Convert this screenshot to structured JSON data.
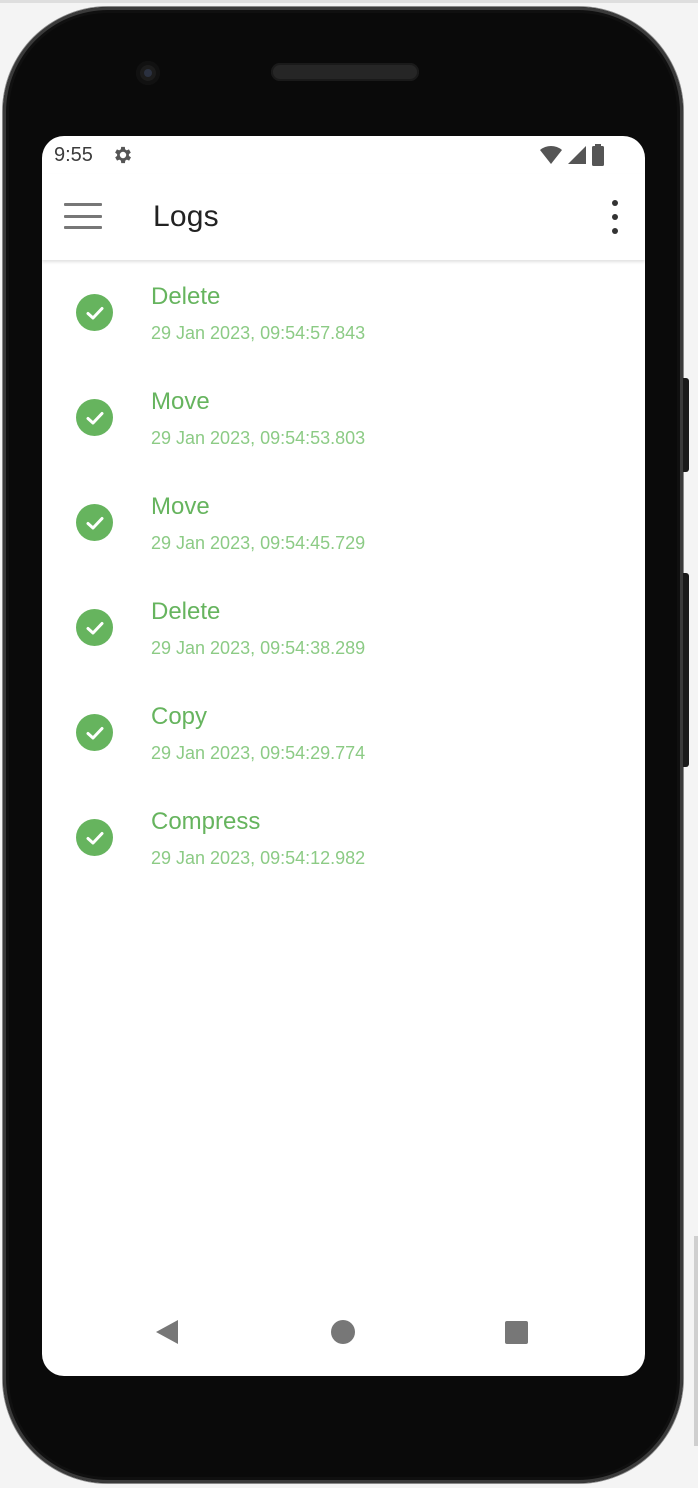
{
  "status_bar": {
    "time": "9:55",
    "icons": [
      "settings-gear-icon",
      "wifi-icon",
      "cellular-signal-icon",
      "battery-icon"
    ]
  },
  "app_bar": {
    "title": "Logs",
    "menu_icon": "hamburger-menu-icon",
    "overflow_icon": "more-vert-icon"
  },
  "logs": [
    {
      "action": "Delete",
      "timestamp": "29 Jan 2023, 09:54:57.843",
      "status_icon": "check-circle-icon"
    },
    {
      "action": "Move",
      "timestamp": "29 Jan 2023, 09:54:53.803",
      "status_icon": "check-circle-icon"
    },
    {
      "action": "Move",
      "timestamp": "29 Jan 2023, 09:54:45.729",
      "status_icon": "check-circle-icon"
    },
    {
      "action": "Delete",
      "timestamp": "29 Jan 2023, 09:54:38.289",
      "status_icon": "check-circle-icon"
    },
    {
      "action": "Copy",
      "timestamp": "29 Jan 2023, 09:54:29.774",
      "status_icon": "check-circle-icon"
    },
    {
      "action": "Compress",
      "timestamp": "29 Jan 2023, 09:54:12.982",
      "status_icon": "check-circle-icon"
    }
  ],
  "nav_bar": {
    "icons": [
      "back-triangle-icon",
      "home-circle-icon",
      "recents-square-icon"
    ]
  },
  "colors": {
    "success_green": "#66b45e",
    "success_green_light": "#8ccb85",
    "title_text": "#222222",
    "icon_grey": "#777777"
  }
}
